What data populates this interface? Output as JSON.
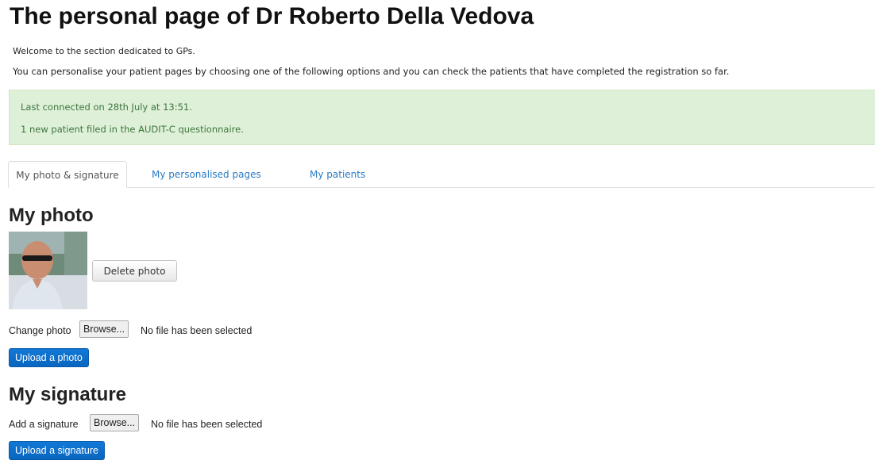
{
  "page": {
    "title": "The personal page of Dr Roberto Della Vedova",
    "welcome": "Welcome to the section dedicated to GPs.",
    "description": "You can personalise your patient pages by choosing one of the following options and you can check the patients that have completed the registration so far."
  },
  "alert": {
    "line1": "Last connected on 28th July at 13:51.",
    "line2": "1 new patient filed in the AUDIT-C questionnaire."
  },
  "tabs": [
    {
      "label": "My photo & signature",
      "active": true
    },
    {
      "label": "My personalised pages",
      "active": false
    },
    {
      "label": "My patients",
      "active": false
    }
  ],
  "photo_section": {
    "heading": "My photo",
    "delete_label": "Delete photo",
    "change_label": "Change photo",
    "browse_label": "Browse...",
    "no_file_text": "No file has been selected",
    "upload_label": "Upload a photo"
  },
  "signature_section": {
    "heading": "My signature",
    "add_label": "Add a signature",
    "browse_label": "Browse...",
    "no_file_text": "No file has been selected",
    "upload_label": "Upload a signature"
  },
  "colors": {
    "alert_bg": "#dff0d8",
    "alert_text": "#3c763d",
    "tab_link": "#2a7bc4",
    "primary_button": "#0a6fcf"
  }
}
